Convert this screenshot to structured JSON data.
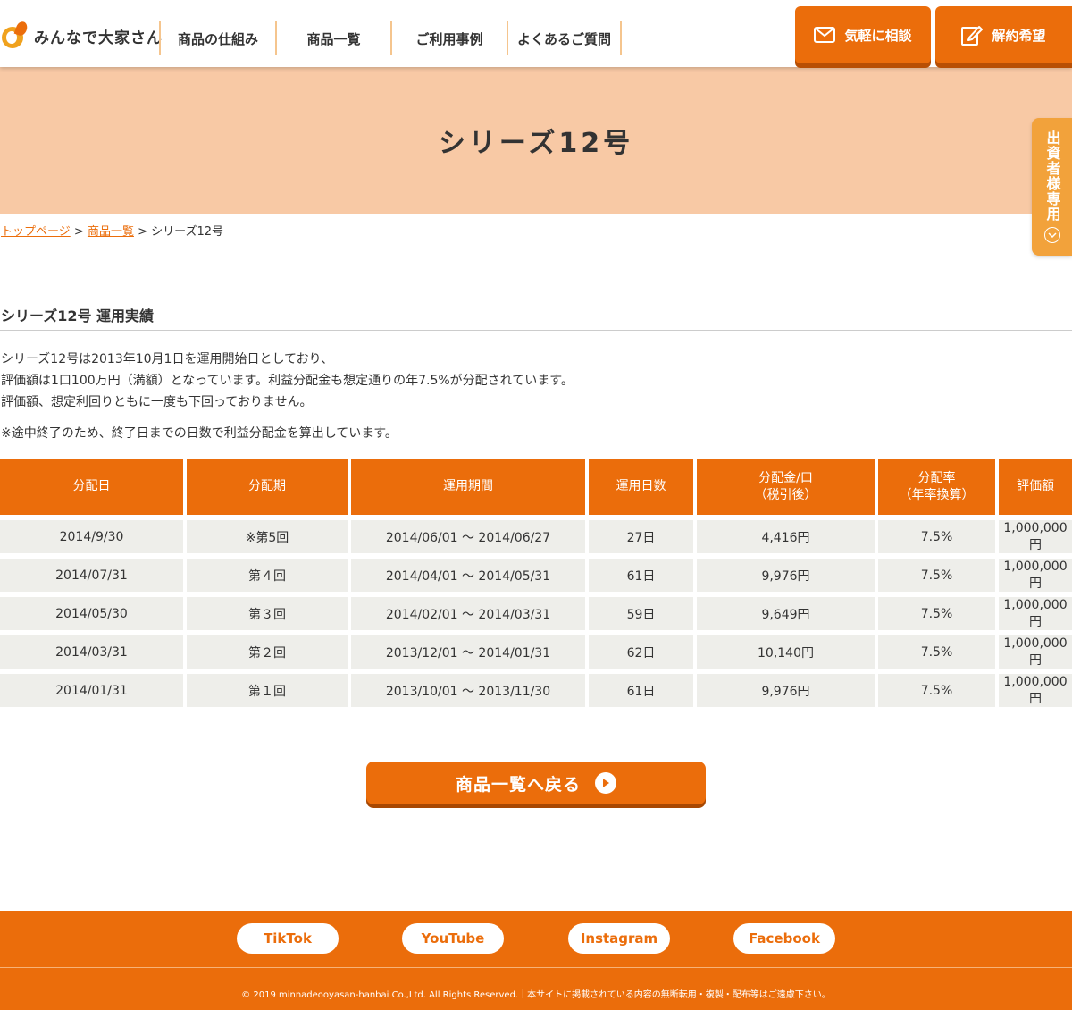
{
  "header": {
    "logo_text": "みんなで大家さん",
    "nav": [
      "商品の仕組み",
      "商品一覧",
      "ご利用事例",
      "よくあるご質問"
    ],
    "contact_label": "気軽に相談",
    "cancel_label": "解約希望"
  },
  "side_tab": {
    "label": "出資者様専用"
  },
  "hero": {
    "title": "シリーズ12号"
  },
  "breadcrumb": {
    "top": "トップページ",
    "list": "商品一覧",
    "current": "シリーズ12号",
    "sep": ">"
  },
  "section": {
    "title": "シリーズ12号 運用実績",
    "intro": [
      "シリーズ12号は2013年10月1日を運用開始日としており、",
      "評価額は1口100万円（満額）となっています。利益分配金も想定通りの年7.5%が分配されています。",
      "評価額、想定利回りともに一度も下回っておりません。"
    ],
    "note": "※途中終了のため、終了日までの日数で利益分配金を算出しています。"
  },
  "table": {
    "headers": [
      {
        "l1": "分配日",
        "l2": ""
      },
      {
        "l1": "分配期",
        "l2": ""
      },
      {
        "l1": "運用期間",
        "l2": ""
      },
      {
        "l1": "運用日数",
        "l2": ""
      },
      {
        "l1": "分配金/口",
        "l2": "（税引後）"
      },
      {
        "l1": "分配率",
        "l2": "（年率換算）"
      },
      {
        "l1": "評価額",
        "l2": ""
      }
    ],
    "rows": [
      [
        "2014/9/30",
        "※第5回",
        "2014/06/01 ～ 2014/06/27",
        "27日",
        "4,416円",
        "7.5%",
        "1,000,000円"
      ],
      [
        "2014/07/31",
        "第４回",
        "2014/04/01 ～ 2014/05/31",
        "61日",
        "9,976円",
        "7.5%",
        "1,000,000円"
      ],
      [
        "2014/05/30",
        "第３回",
        "2014/02/01 ～ 2014/03/31",
        "59日",
        "9,649円",
        "7.5%",
        "1,000,000円"
      ],
      [
        "2014/03/31",
        "第２回",
        "2013/12/01 ～ 2014/01/31",
        "62日",
        "10,140円",
        "7.5%",
        "1,000,000円"
      ],
      [
        "2014/01/31",
        "第１回",
        "2013/10/01 ～ 2013/11/30",
        "61日",
        "9,976円",
        "7.5%",
        "1,000,000円"
      ]
    ]
  },
  "back_button": {
    "label": "商品一覧へ戻る"
  },
  "footer": {
    "sns": [
      "TikTok",
      "YouTube",
      "Instagram",
      "Facebook"
    ],
    "copyright": "© 2019 minnadeooyasan-hanbai Co.,Ltd. All Rights Reserved.｜本サイトに掲載されている内容の無断転用・複製・配布等はご遠慮下さい。"
  },
  "colors": {
    "accent": "#eb6d0b",
    "hero_bg": "#f8c9a5",
    "side_tab": "#f2a23b",
    "row_bg": "#eeeeea"
  }
}
